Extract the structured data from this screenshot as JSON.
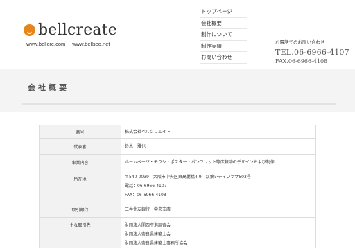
{
  "header": {
    "logo_text": "bellcreate",
    "urls": [
      "www.bellcre.com",
      "www.bellseo.net"
    ],
    "nav": [
      "トップページ",
      "会社概要",
      "制作について",
      "制作実績",
      "お問い合わせ"
    ],
    "contact": {
      "label": "お電話でのお問い合わせ",
      "tel": "TEL.06-6966-4107",
      "fax": "FAX.06-6966-4108"
    }
  },
  "page": {
    "title": "会社概要"
  },
  "colors": {
    "logo_accent": "#e8841c",
    "title_band": "#f4f4f4",
    "label_cell": "#f2f2f2"
  },
  "company": {
    "rows": [
      {
        "label": "商号",
        "lines": [
          "株式会社ベルクリエイト"
        ]
      },
      {
        "label": "代表者",
        "lines": [
          "鈴木　雅也"
        ]
      },
      {
        "label": "事業内容",
        "lines": [
          "ホームページ・チラシ・ポスター・パンフレット等広報物のデザインおよび制作"
        ]
      },
      {
        "label": "所在地",
        "lines": [
          "〒540-0039　大阪市中央区東高麗橋4-9　双葉シティプラザ503号",
          "電話：06-6966-4107",
          "FAX：06-6966-4108"
        ]
      },
      {
        "label": "取引銀行",
        "lines": [
          "三井住友銀行　中央支店"
        ]
      },
      {
        "label": "主な取引先",
        "lines": [
          "財団法人関西空港調査会",
          "財団法人奈良県建築士会",
          "財団法人奈良県建築士事務所協会"
        ]
      }
    ]
  }
}
